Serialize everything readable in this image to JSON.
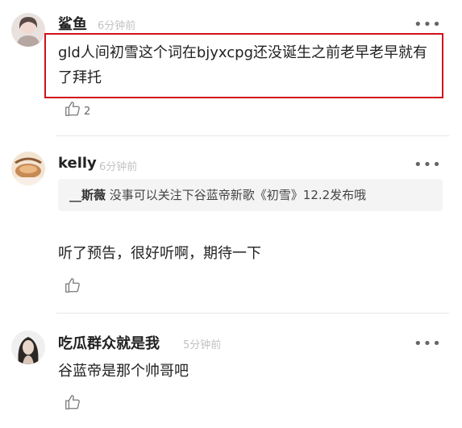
{
  "comments": [
    {
      "username": "鲨鱼",
      "time": "6分钟前",
      "text": "gld人间初雪这个词在bjyxcpg还没诞生之前老早老早就有了拜托",
      "like_count": "2",
      "more": "•••"
    },
    {
      "username": "kelly",
      "time": "6分钟前",
      "reply_to_name": "__斯薇",
      "reply_to_text": " 没事可以关注下谷蓝帝新歌《初雪》12.2发布哦",
      "text": "听了预告，很好听啊，期待一下",
      "more": "•••"
    },
    {
      "username": "吃瓜群众就是我",
      "time": "5分钟前",
      "text": "谷蓝帝是那个帅哥吧",
      "more": "•••"
    }
  ],
  "colors": {
    "highlight_border": "#d0111b",
    "time_text": "#c2c2c2",
    "quote_bg": "#f4f4f4"
  }
}
